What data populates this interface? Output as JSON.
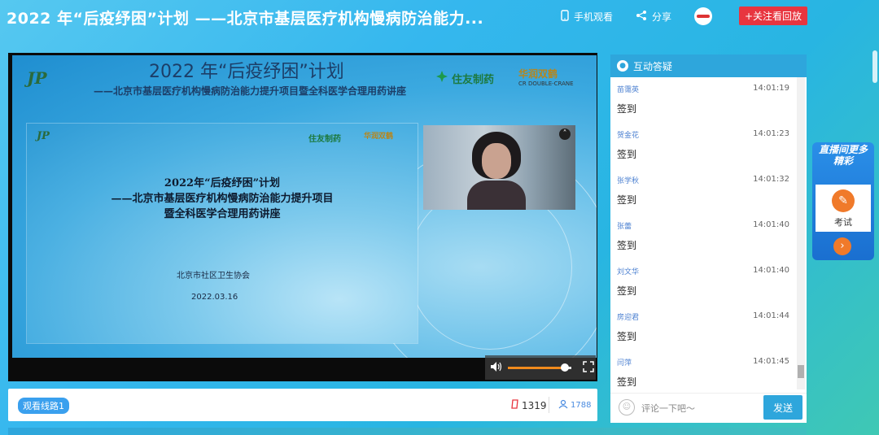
{
  "header": {
    "title": "2022 年“后疫纾困”计划 ——北京市基层医疗机构慢病防治能力...",
    "mobile_view": "手机观看",
    "share": "分享",
    "follow_button": "+关注看回放"
  },
  "slide": {
    "logo": "JP",
    "title": "2022 年“后疫纾困”计划",
    "subtitle": "——北京市基层医疗机构慢病防治能力提升项目暨全科医学合理用药讲座",
    "brand1": "住友制药",
    "brand2": "华润双鹤",
    "brand2_en": "CR DOUBLE-CRANE",
    "inner": {
      "logo": "JP",
      "brand1": "住友制药",
      "brand2": "华润双鹤",
      "title_line1": "2022年“后疫纾困”计划",
      "title_line2": "——北京市基层医疗机构慢病防治能力提升项目",
      "title_line3": "暨全科医学合理用药讲座",
      "org": "北京市社区卫生协会",
      "date": "2022.03.16"
    }
  },
  "player": {
    "volume": 0.9,
    "route_button": "观看线路1",
    "likes": "1319",
    "viewers": "1788"
  },
  "chat": {
    "title": "互动答疑",
    "messages": [
      {
        "name": "苗霭英",
        "time": "14:01:19",
        "text": "签到"
      },
      {
        "name": "贺金花",
        "time": "14:01:23",
        "text": "签到"
      },
      {
        "name": "张学秋",
        "time": "14:01:32",
        "text": "签到"
      },
      {
        "name": "张蕾",
        "time": "14:01:40",
        "text": "签到"
      },
      {
        "name": "刘文华",
        "time": "14:01:40",
        "text": "签到"
      },
      {
        "name": "房迎君",
        "time": "14:01:44",
        "text": "签到"
      },
      {
        "name": "闫萍",
        "time": "14:01:45",
        "text": "签到"
      }
    ],
    "input_placeholder": "评论一下吧～",
    "send_button": "发送"
  },
  "side_widget": {
    "banner": "直播间更多精彩",
    "exam_label": "考试"
  },
  "colors": {
    "accent": "#2ea6dc",
    "follow": "#e8353f",
    "exam": "#f07a2a"
  }
}
